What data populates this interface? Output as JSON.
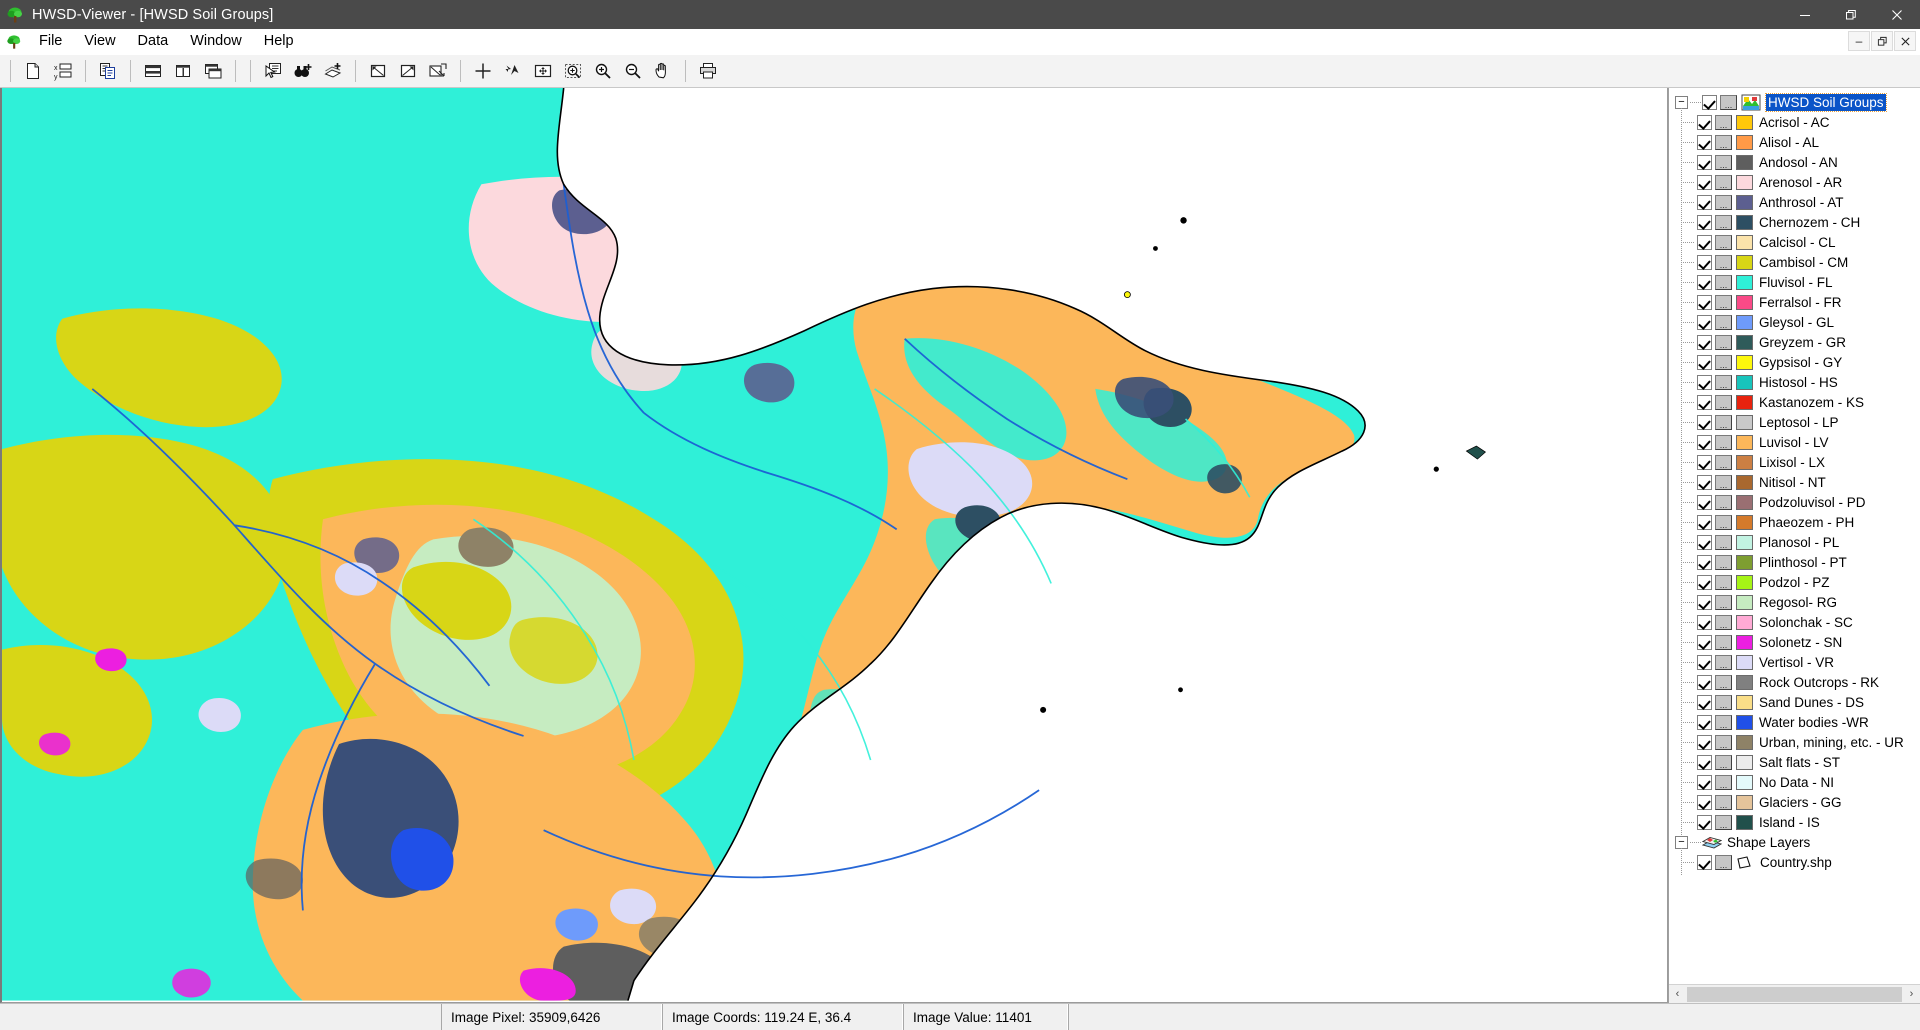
{
  "window": {
    "title": "HWSD-Viewer - [HWSD Soil Groups]",
    "app_icon": "tree-icon",
    "controls": [
      {
        "name": "minimize-button",
        "glyph": "—"
      },
      {
        "name": "restore-button",
        "glyph": "❐"
      },
      {
        "name": "close-button",
        "glyph": "✕"
      }
    ],
    "mdi_controls": [
      {
        "name": "mdi-minimize-button",
        "glyph": "–"
      },
      {
        "name": "mdi-restore-button",
        "glyph": "❐"
      },
      {
        "name": "mdi-close-button",
        "glyph": "✕"
      }
    ]
  },
  "menu": {
    "icon": "tree-icon",
    "items": [
      {
        "label": "File"
      },
      {
        "label": "View"
      },
      {
        "label": "Data"
      },
      {
        "label": "Window"
      },
      {
        "label": "Help"
      }
    ]
  },
  "toolbar": {
    "groups": [
      {
        "buttons": [
          {
            "name": "new-document-button",
            "icon": "new-document-icon"
          },
          {
            "name": "attribute-table-button",
            "icon": "xy-table-icon"
          }
        ]
      },
      {
        "buttons": [
          {
            "name": "copy-report-button",
            "icon": "copy-document-icon"
          }
        ]
      },
      {
        "buttons": [
          {
            "name": "tile-horizontal-button",
            "icon": "tile-horizontal-icon"
          },
          {
            "name": "tile-vertical-button",
            "icon": "tile-vertical-icon"
          },
          {
            "name": "cascade-windows-button",
            "icon": "cascade-windows-icon"
          }
        ]
      },
      {
        "buttons": [
          {
            "name": "identify-record-button",
            "icon": "pointer-table-icon"
          },
          {
            "name": "add-selection-button",
            "icon": "binoculars-plus-icon"
          },
          {
            "name": "add-layer-button",
            "icon": "layer-plus-icon"
          }
        ]
      },
      {
        "buttons": [
          {
            "name": "select-area-button",
            "icon": "select-rectangle-icon"
          },
          {
            "name": "select-area-alt-button",
            "icon": "select-rectangle-alt-icon"
          },
          {
            "name": "select-multi-button",
            "icon": "select-multi-icon"
          }
        ]
      },
      {
        "buttons": [
          {
            "name": "crosshair-button",
            "icon": "crosshair-icon"
          },
          {
            "name": "flash-feature-button",
            "icon": "flash-arrow-icon"
          },
          {
            "name": "zoom-full-extent-button",
            "icon": "zoom-extent-icon"
          },
          {
            "name": "zoom-window-button",
            "icon": "zoom-window-icon"
          },
          {
            "name": "zoom-in-button",
            "icon": "zoom-in-icon"
          },
          {
            "name": "zoom-out-button",
            "icon": "zoom-out-icon"
          },
          {
            "name": "pan-button",
            "icon": "pan-hand-icon"
          }
        ]
      },
      {
        "buttons": [
          {
            "name": "print-button",
            "icon": "print-icon"
          }
        ]
      }
    ]
  },
  "toc": {
    "root": {
      "label": "HWSD Soil Groups",
      "icon": "raster-layer-icon",
      "checked": true,
      "expanded": true,
      "selected": true
    },
    "legend": [
      {
        "label": "Acrisol - AC",
        "color": "#ffc80a"
      },
      {
        "label": "Alisol - AL",
        "color": "#ff9a47"
      },
      {
        "label": "Andosol - AN",
        "color": "#5e5e5e"
      },
      {
        "label": "Arenosol - AR",
        "color": "#fcd9dd"
      },
      {
        "label": "Anthrosol - AT",
        "color": "#5c5f90"
      },
      {
        "label": "Chernozem - CH",
        "color": "#2d4f63"
      },
      {
        "label": "Calcisol - CL",
        "color": "#fbe3ab"
      },
      {
        "label": "Cambisol - CM",
        "color": "#d8d616"
      },
      {
        "label": "Fluvisol - FL",
        "color": "#2ff0d8"
      },
      {
        "label": "Ferralsol - FR",
        "color": "#fa4a87"
      },
      {
        "label": "Gleysol - GL",
        "color": "#6e9bfb"
      },
      {
        "label": "Greyzem - GR",
        "color": "#2f5b5a"
      },
      {
        "label": "Gypsisol - GY",
        "color": "#fdf80c"
      },
      {
        "label": "Histosol - HS",
        "color": "#18c4bc"
      },
      {
        "label": "Kastanozem - KS",
        "color": "#e8230e"
      },
      {
        "label": "Leptosol - LP",
        "color": "#c9c9c9"
      },
      {
        "label": "Luvisol - LV",
        "color": "#fcb75a"
      },
      {
        "label": "Lixisol - LX",
        "color": "#cc7f43"
      },
      {
        "label": "Nitisol - NT",
        "color": "#a9682f"
      },
      {
        "label": "Podzoluvisol - PD",
        "color": "#9a6f72"
      },
      {
        "label": "Phaeozem - PH",
        "color": "#d47a2b"
      },
      {
        "label": "Planosol - PL",
        "color": "#c2f3e2"
      },
      {
        "label": "Plinthosol - PT",
        "color": "#7e9e31"
      },
      {
        "label": "Podzol - PZ",
        "color": "#a6f416"
      },
      {
        "label": "Regosol- RG",
        "color": "#c6ecc1"
      },
      {
        "label": "Solonchak - SC",
        "color": "#ffaad5"
      },
      {
        "label": "Solonetz - SN",
        "color": "#ec1fe0"
      },
      {
        "label": "Vertisol - VR",
        "color": "#dcdbf7"
      },
      {
        "label": "Rock Outcrops - RK",
        "color": "#808080"
      },
      {
        "label": "Sand Dunes - DS",
        "color": "#fade88"
      },
      {
        "label": "Water bodies -WR",
        "color": "#2050e8"
      },
      {
        "label": "Urban, mining, etc. - UR",
        "color": "#8e8267"
      },
      {
        "label": "Salt flats - ST",
        "color": "#ececec"
      },
      {
        "label": "No Data - NI",
        "color": "#e4fafb"
      },
      {
        "label": "Glaciers - GG",
        "color": "#e5c49b"
      },
      {
        "label": "Island - IS",
        "color": "#21504b"
      }
    ],
    "shape_layers": {
      "label": "Shape Layers",
      "icon": "shape-layers-icon",
      "expanded": true,
      "items": [
        {
          "label": "Country.shp",
          "icon": "polygon-icon",
          "checked": true
        }
      ]
    },
    "scrollbar": {
      "left_glyph": "‹",
      "right_glyph": "›"
    }
  },
  "statusbar": {
    "cells": [
      {
        "name": "status-image-pixel",
        "text": "Image Pixel: 35909,6426"
      },
      {
        "name": "status-image-coords",
        "text": "Image Coords: 119.24 E, 36.4"
      },
      {
        "name": "status-image-value",
        "text": "Image Value: 11401"
      }
    ]
  },
  "map": {
    "background": "#ffffff",
    "sea_color": "#ffffff",
    "river_color": "#1b5fd4",
    "coast_color": "#000000"
  }
}
